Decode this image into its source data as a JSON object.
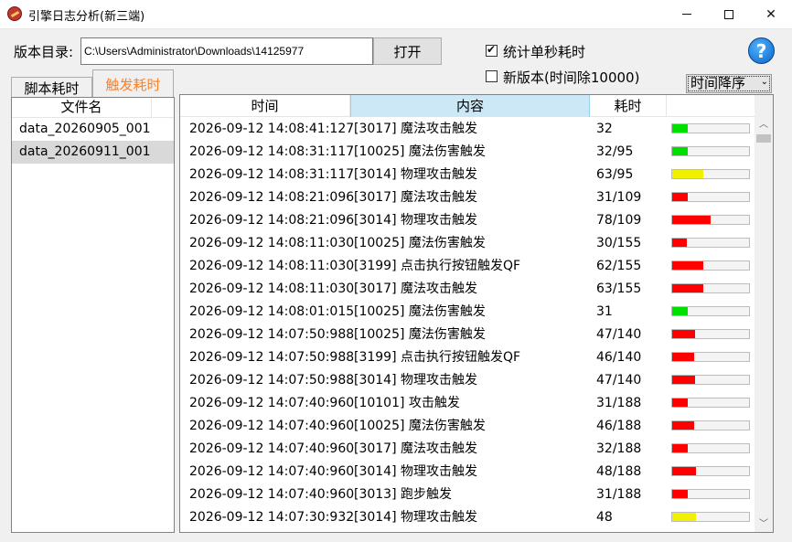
{
  "window": {
    "title": "引擎日志分析(新三端)"
  },
  "toolbar": {
    "dir_label": "版本目录:",
    "dir_value": "C:\\Users\\Administrator\\Downloads\\14125977",
    "open_label": "打开",
    "stat_label": "统计单秒耗时",
    "stat_checked": true,
    "newver_label": "新版本(时间除10000)",
    "newver_checked": false,
    "sort_selected": "时间降序"
  },
  "tabs": [
    {
      "label": "脚本耗时",
      "active": false
    },
    {
      "label": "触发耗时",
      "active": true
    }
  ],
  "file_list": {
    "header": "文件名",
    "items": [
      "data_20260905_001",
      "data_20260911_001"
    ],
    "selected_index": 1
  },
  "table": {
    "headers": [
      "时间",
      "内容",
      "耗时",
      ""
    ],
    "rows": [
      {
        "time": "2026-09-12 14:08:41:127",
        "content": "[3017]   魔法攻击触发",
        "cost": "32",
        "level": 0.2,
        "color": "#00e000"
      },
      {
        "time": "2026-09-12 14:08:31:117",
        "content": "[10025] 魔法伤害触发",
        "cost": "32/95",
        "level": 0.2,
        "color": "#00e000"
      },
      {
        "time": "2026-09-12 14:08:31:117",
        "content": "[3014]   物理攻击触发",
        "cost": "63/95",
        "level": 0.4,
        "color": "#f0f000"
      },
      {
        "time": "2026-09-12 14:08:21:096",
        "content": "[3017]   魔法攻击触发",
        "cost": "31/109",
        "level": 0.2,
        "color": "#ff0000"
      },
      {
        "time": "2026-09-12 14:08:21:096",
        "content": "[3014]   物理攻击触发",
        "cost": "78/109",
        "level": 0.5,
        "color": "#ff0000"
      },
      {
        "time": "2026-09-12 14:08:11:030",
        "content": "[10025] 魔法伤害触发",
        "cost": "30/155",
        "level": 0.19,
        "color": "#ff0000"
      },
      {
        "time": "2026-09-12 14:08:11:030",
        "content": "[3199]   点击执行按钮触发QF",
        "cost": "62/155",
        "level": 0.4,
        "color": "#ff0000"
      },
      {
        "time": "2026-09-12 14:08:11:030",
        "content": "[3017]   魔法攻击触发",
        "cost": "63/155",
        "level": 0.4,
        "color": "#ff0000"
      },
      {
        "time": "2026-09-12 14:08:01:015",
        "content": "[10025] 魔法伤害触发",
        "cost": "31",
        "level": 0.2,
        "color": "#00e000"
      },
      {
        "time": "2026-09-12 14:07:50:988",
        "content": "[10025] 魔法伤害触发",
        "cost": "47/140",
        "level": 0.3,
        "color": "#ff0000"
      },
      {
        "time": "2026-09-12 14:07:50:988",
        "content": "[3199]   点击执行按钮触发QF",
        "cost": "46/140",
        "level": 0.29,
        "color": "#ff0000"
      },
      {
        "time": "2026-09-12 14:07:50:988",
        "content": "[3014]   物理攻击触发",
        "cost": "47/140",
        "level": 0.3,
        "color": "#ff0000"
      },
      {
        "time": "2026-09-12 14:07:40:960",
        "content": "[10101] 攻击触发",
        "cost": "31/188",
        "level": 0.2,
        "color": "#ff0000"
      },
      {
        "time": "2026-09-12 14:07:40:960",
        "content": "[10025] 魔法伤害触发",
        "cost": "46/188",
        "level": 0.29,
        "color": "#ff0000"
      },
      {
        "time": "2026-09-12 14:07:40:960",
        "content": "[3017]   魔法攻击触发",
        "cost": "32/188",
        "level": 0.2,
        "color": "#ff0000"
      },
      {
        "time": "2026-09-12 14:07:40:960",
        "content": "[3014]   物理攻击触发",
        "cost": "48/188",
        "level": 0.31,
        "color": "#ff0000"
      },
      {
        "time": "2026-09-12 14:07:40:960",
        "content": "[3013]   跑步触发",
        "cost": "31/188",
        "level": 0.2,
        "color": "#ff0000"
      },
      {
        "time": "2026-09-12 14:07:30:932",
        "content": "[3014]   物理攻击触发",
        "cost": "48",
        "level": 0.31,
        "color": "#f0f000"
      }
    ]
  }
}
